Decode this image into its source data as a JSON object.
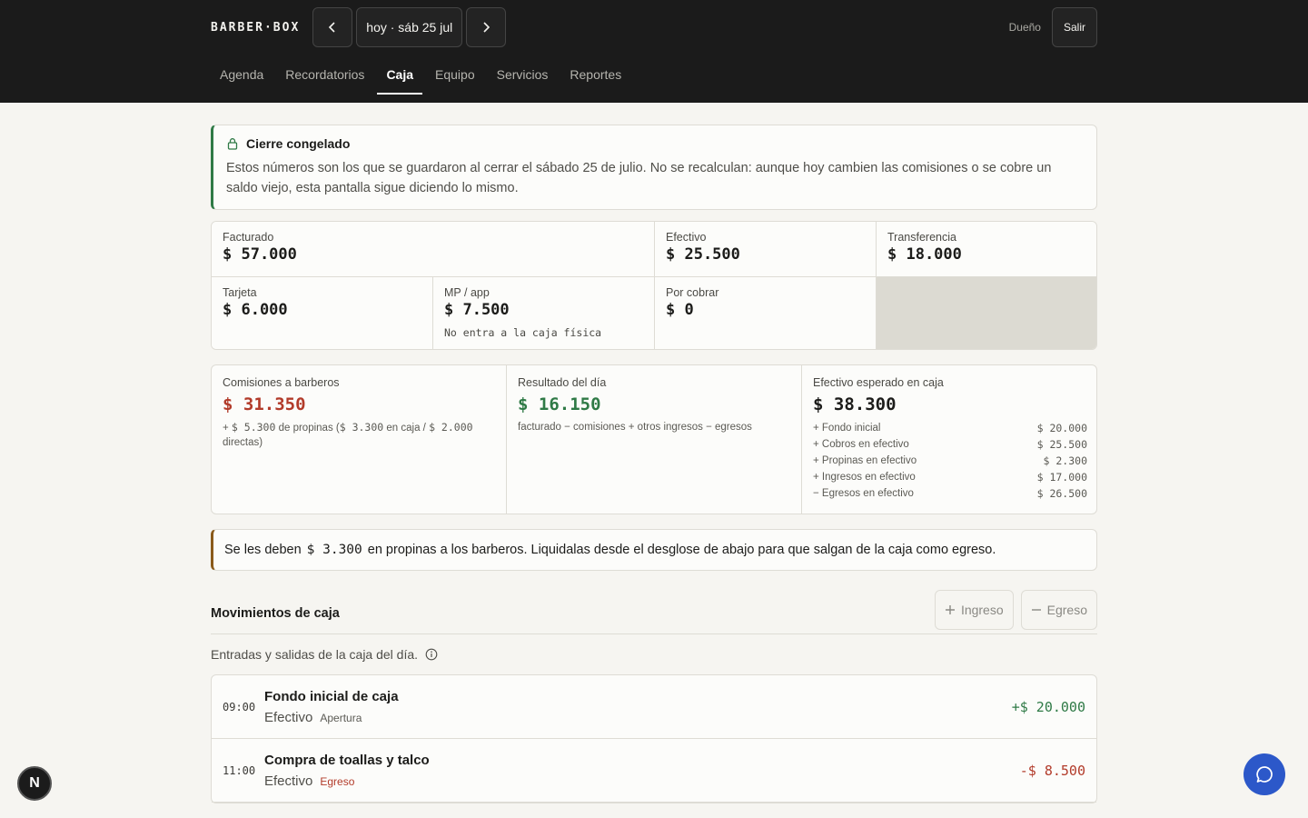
{
  "header": {
    "logo": "BARBER·BOX",
    "date_label": "hoy · sáb 25 jul",
    "role": "Dueño",
    "logout": "Salir",
    "tabs": [
      {
        "label": "Agenda"
      },
      {
        "label": "Recordatorios"
      },
      {
        "label": "Caja",
        "active": true
      },
      {
        "label": "Equipo"
      },
      {
        "label": "Servicios"
      },
      {
        "label": "Reportes"
      }
    ]
  },
  "notice": {
    "title": "Cierre congelado",
    "text": "Estos números son los que se guardaron al cerrar el sábado 25 de julio. No se recalculan: aunque hoy cambien las comisiones o se cobre un saldo viejo, esta pantalla sigue diciendo lo mismo."
  },
  "totals": {
    "facturado": {
      "label": "Facturado",
      "value": "$ 57.000"
    },
    "efectivo": {
      "label": "Efectivo",
      "value": "$ 25.500"
    },
    "transferencia": {
      "label": "Transferencia",
      "value": "$ 18.000"
    },
    "tarjeta": {
      "label": "Tarjeta",
      "value": "$ 6.000"
    },
    "mp": {
      "label": "MP / app",
      "value": "$ 7.500",
      "note": "No entra a la caja física"
    },
    "por_cobrar": {
      "label": "Por cobrar",
      "value": "$ 0"
    }
  },
  "summary": {
    "comisiones": {
      "label": "Comisiones a barberos",
      "value": "$ 31.350",
      "note_prefix": "+",
      "note_tips": "$ 5.300",
      "note_mid": "de propinas (",
      "note_caja": "$ 3.300",
      "note_mid2": "en caja /",
      "note_directas": "$ 2.000",
      "note_end": "directas)"
    },
    "resultado": {
      "label": "Resultado del día",
      "value": "$ 16.150",
      "note": "facturado − comisiones + otros ingresos − egresos"
    },
    "esperado": {
      "label": "Efectivo esperado en caja",
      "value": "$ 38.300",
      "rows": [
        {
          "label": "+ Fondo inicial",
          "value": "$ 20.000"
        },
        {
          "label": "+ Cobros en efectivo",
          "value": "$ 25.500"
        },
        {
          "label": "+ Propinas en efectivo",
          "value": "$ 2.300"
        },
        {
          "label": "+ Ingresos en efectivo",
          "value": "$ 17.000"
        },
        {
          "label": "− Egresos en efectivo",
          "value": "$ 26.500"
        }
      ]
    }
  },
  "tip_notice": {
    "prefix": "Se les deben",
    "amount": "$ 3.300",
    "suffix": "en propinas a los barberos. Liquidalas desde el desglose de abajo para que salgan de la caja como egreso."
  },
  "movimientos": {
    "title": "Movimientos de caja",
    "ingreso_label": "Ingreso",
    "egreso_label": "Egreso",
    "subtitle": "Entradas y salidas de la caja del día.",
    "items": [
      {
        "time": "09:00",
        "title": "Fondo inicial de caja",
        "method": "Efectivo",
        "tag": "Apertura",
        "amount": "+$ 20.000"
      },
      {
        "time": "11:00",
        "title": "Compra de toallas y talco",
        "method": "Efectivo",
        "tag": "Egreso",
        "amount": "-$ 8.500"
      }
    ]
  },
  "colors": {
    "header_bg": "#1b1b1b",
    "positive": "#2f7a46",
    "negative": "#b23b2a",
    "chat_button": "#2c58c9"
  },
  "icons": {
    "prev": "chevron-left-icon",
    "next": "chevron-right-icon",
    "lock": "lock-icon",
    "plus": "plus-icon",
    "minus": "minus-icon",
    "info": "info-icon",
    "chat": "chat-bubble-icon",
    "dev": "next-logo-icon"
  },
  "dev_badge": "N"
}
